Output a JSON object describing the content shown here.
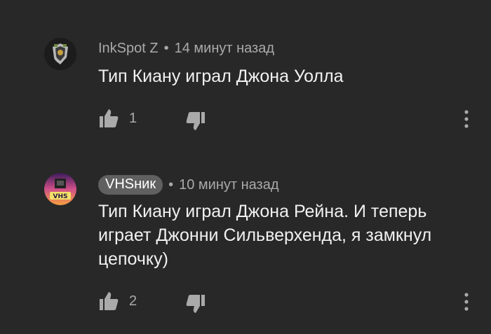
{
  "comments": [
    {
      "author": "InkSpot Z",
      "separator": "•",
      "time": "14 минут назад",
      "text": "Тип Киану играл Джона Уолла",
      "likes": "1",
      "avatar_icon": "crest-emblem-icon",
      "author_badge": false
    },
    {
      "author": "VHSник",
      "separator": "•",
      "time": "10 минут назад",
      "text": "Тип Киану играл Джона Рейна. И теперь играет Джонни Сильверхенда, я замкнул цепочку)",
      "likes": "2",
      "avatar_icon": "vhs-logo-icon",
      "author_badge": true
    }
  ],
  "icons": {
    "like": "thumb-up-icon",
    "dislike": "thumb-down-icon",
    "more": "more-vert-icon"
  },
  "colors": {
    "background": "#282828",
    "text_primary": "#f1f1f1",
    "text_secondary": "#aaaaaa",
    "badge_bg": "#606060"
  }
}
